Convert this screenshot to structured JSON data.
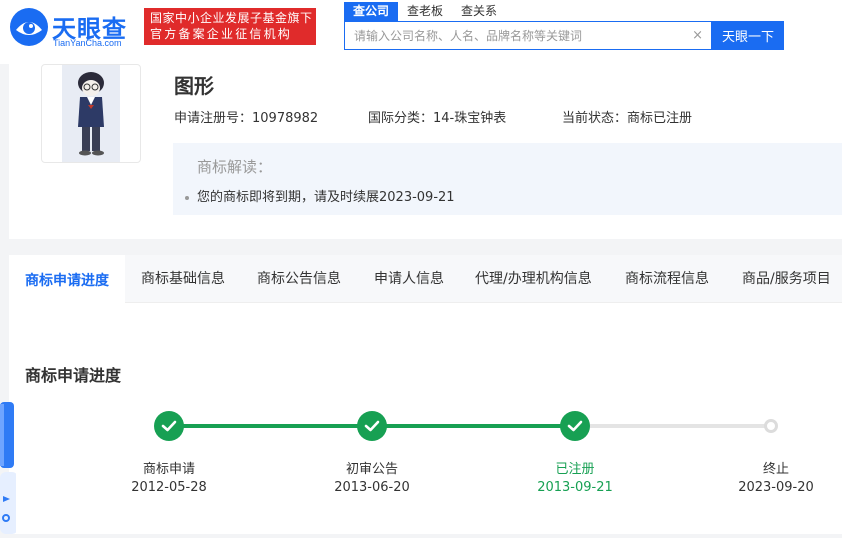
{
  "header": {
    "logo_text": "天眼查",
    "logo_sub": "TianYanCha.com",
    "badge_line1": "国家中小企业发展子基金旗下",
    "badge_line2": "官方备案企业征信机构",
    "search_tabs": [
      "查公司",
      "查老板",
      "查关系"
    ],
    "search_placeholder": "请输入公司名称、人名、品牌名称等关键词",
    "search_button": "天眼一下"
  },
  "trademark": {
    "name": "图形",
    "reg_no": "申请注册号：10978982",
    "intl_class": "国际分类：14-珠宝钟表",
    "status": "当前状态：商标已注册",
    "interp_title": "商标解读：",
    "interp_item": "您的商标即将到期，请及时续展2023-09-21"
  },
  "tabs": [
    "商标申请进度",
    "商标基础信息",
    "商标公告信息",
    "申请人信息",
    "代理/办理机构信息",
    "商标流程信息",
    "商品/服务项目"
  ],
  "progress": {
    "title": "商标申请进度",
    "steps": [
      {
        "label": "商标申请",
        "date": "2012-05-28",
        "state": "done"
      },
      {
        "label": "初审公告",
        "date": "2013-06-20",
        "state": "done"
      },
      {
        "label": "已注册",
        "date": "2013-09-21",
        "state": "current"
      },
      {
        "label": "终止",
        "date": "2023-09-20",
        "state": "pending"
      }
    ]
  },
  "colors": {
    "brand_blue": "#1a6cf2",
    "badge_red": "#e02b2b",
    "success_green": "#17a053"
  }
}
